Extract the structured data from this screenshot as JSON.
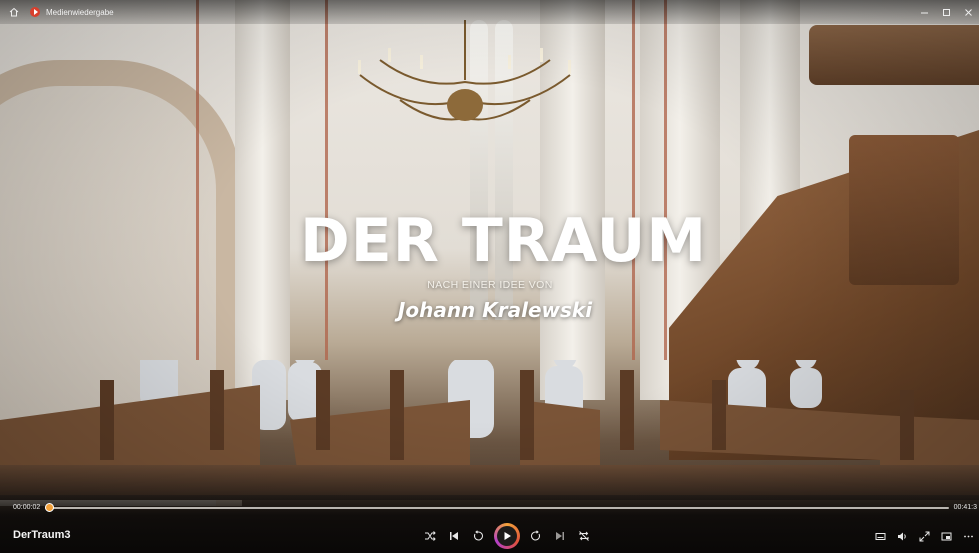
{
  "window": {
    "home_icon": "home-icon",
    "app_icon": "media-player-icon",
    "app_name": "Medienwiedergabe",
    "controls": [
      "minimize-icon",
      "maximize-icon",
      "close-icon"
    ]
  },
  "video": {
    "title_overlay": "DER TRAUM",
    "subtitle": "NACH EINER IDEE VON",
    "author": "Johann Kralewski"
  },
  "player": {
    "current_time": "00:00:02",
    "total_time": "00:41:3",
    "progress": 0.002,
    "media_title": "DerTraum3",
    "accent_colors": [
      "#f4a33a",
      "#e0523c",
      "#b43fc9"
    ],
    "center_buttons": [
      "shuffle-icon",
      "previous-icon",
      "rewind-10-icon",
      "play-icon",
      "forward-30-icon",
      "next-icon",
      "repeat-off-icon"
    ],
    "right_buttons": [
      "subtitles-icon",
      "volume-icon",
      "fullscreen-icon",
      "miniplayer-icon",
      "more-icon"
    ]
  }
}
